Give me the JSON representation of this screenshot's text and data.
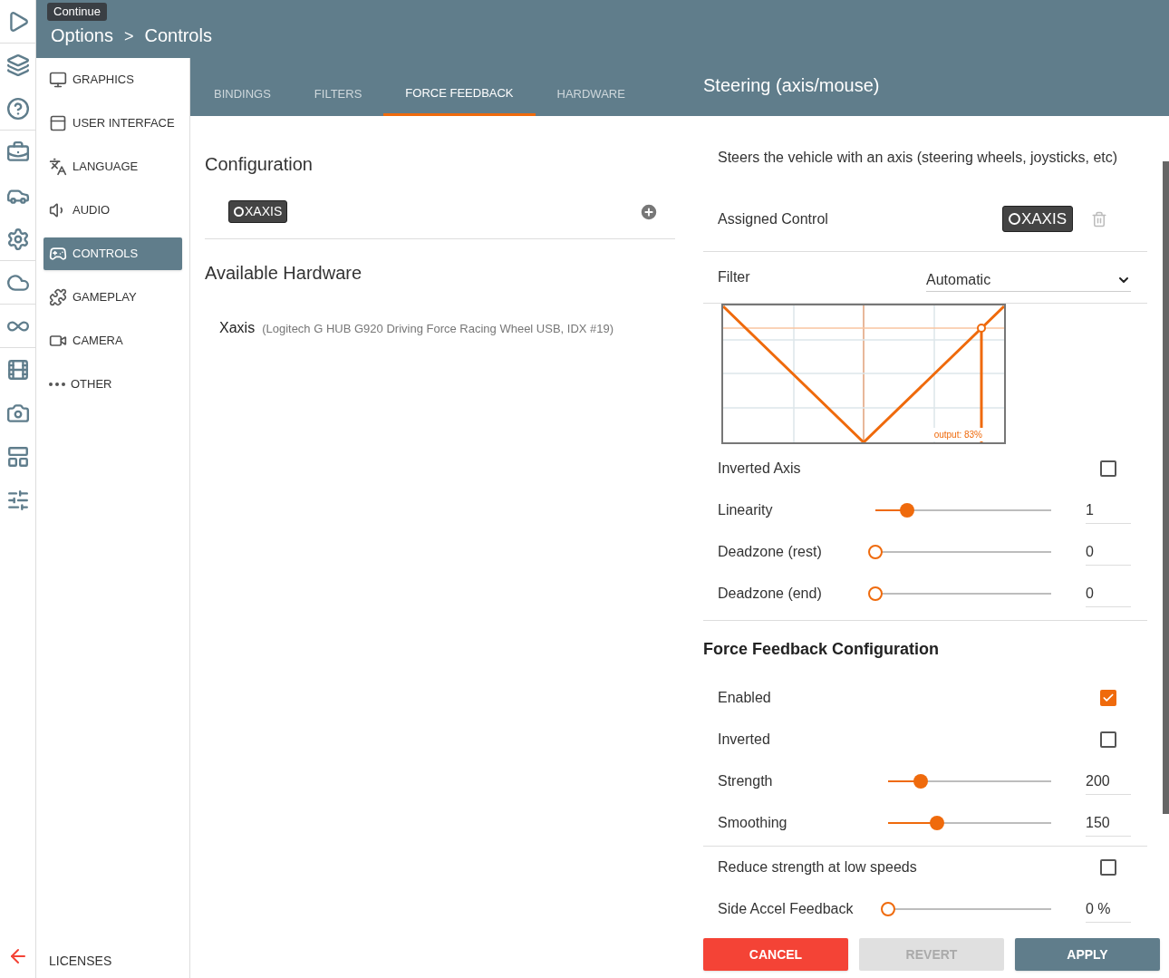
{
  "tooltip": "Continue",
  "breadcrumb": {
    "parent": "Options",
    "separator": ">",
    "current": "Controls"
  },
  "nav": {
    "items": [
      {
        "label": "GRAPHICS",
        "selected": false
      },
      {
        "label": "USER INTERFACE",
        "selected": false
      },
      {
        "label": "LANGUAGE",
        "selected": false
      },
      {
        "label": "AUDIO",
        "selected": false
      },
      {
        "label": "CONTROLS",
        "selected": true
      },
      {
        "label": "GAMEPLAY",
        "selected": false
      },
      {
        "label": "CAMERA",
        "selected": false
      },
      {
        "label": "OTHER",
        "selected": false
      }
    ],
    "footer": "LICENSES"
  },
  "tabs": [
    {
      "label": "BINDINGS",
      "selected": false
    },
    {
      "label": "FILTERS",
      "selected": false
    },
    {
      "label": "FORCE FEEDBACK",
      "selected": true
    },
    {
      "label": "HARDWARE",
      "selected": false
    }
  ],
  "configuration": {
    "title": "Configuration",
    "bindings": [
      {
        "label": "XAXIS"
      }
    ]
  },
  "hardware": {
    "title": "Available Hardware",
    "devices": [
      {
        "name": "Xaxis",
        "detail": "(Logitech G HUB G920 Driving Force Racing Wheel USB, IDX #19)"
      }
    ]
  },
  "panel": {
    "title": "Steering (axis/mouse)",
    "description": "Steers the vehicle with an axis (steering wheels, joysticks, etc)",
    "assigned": {
      "label": "Assigned Control",
      "binding": "XAXIS"
    },
    "filter": {
      "label": "Filter",
      "value": "Automatic"
    },
    "curve": {
      "output_label": "output: 83%"
    },
    "axis_rows": [
      {
        "kind": "checkbox",
        "label": "Inverted Axis",
        "checked": false
      },
      {
        "kind": "slider",
        "label": "Linearity",
        "level": 0.18,
        "value": "1"
      },
      {
        "kind": "slider",
        "label": "Deadzone (rest)",
        "level": 0,
        "value": "0"
      },
      {
        "kind": "slider",
        "label": "Deadzone (end)",
        "level": 0,
        "value": "0"
      }
    ],
    "ff": {
      "title": "Force Feedback Configuration",
      "rows": [
        {
          "kind": "checkbox",
          "label": "Enabled",
          "checked": true
        },
        {
          "kind": "checkbox",
          "label": "Inverted",
          "checked": false
        },
        {
          "kind": "slider",
          "label": "Strength",
          "level": 0.2,
          "value": "200"
        },
        {
          "kind": "slider",
          "label": "Smoothing",
          "level": 0.3,
          "value": "150"
        }
      ],
      "extra_rows": [
        {
          "kind": "checkbox",
          "label": "Reduce strength at low speeds",
          "checked": false
        },
        {
          "kind": "slider",
          "label": "Side Accel Feedback",
          "level": 0,
          "value": "0 %"
        }
      ]
    }
  },
  "buttons": [
    {
      "label": "CANCEL",
      "kind": "danger"
    },
    {
      "label": "REVERT",
      "kind": "disabled"
    },
    {
      "label": "APPLY",
      "kind": "primary"
    }
  ]
}
